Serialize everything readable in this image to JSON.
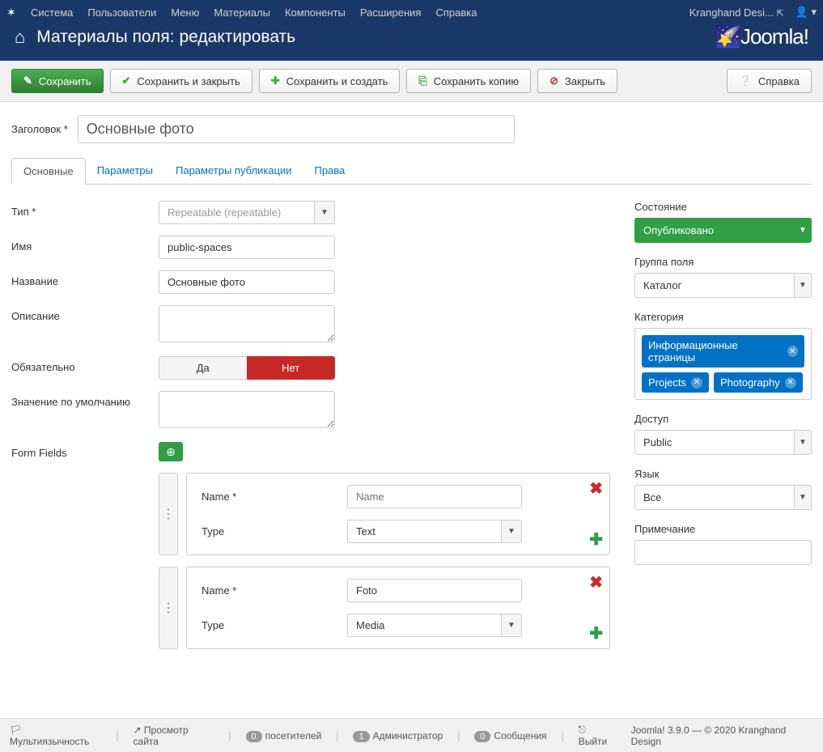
{
  "topnav": {
    "menus": [
      "Система",
      "Пользователи",
      "Меню",
      "Материалы",
      "Компоненты",
      "Расширения",
      "Справка"
    ],
    "site_name": "Kranghand Desi..."
  },
  "header": {
    "title": "Материалы поля: редактировать",
    "brand": "Joomla!"
  },
  "toolbar": {
    "save": "Сохранить",
    "save_close": "Сохранить и закрыть",
    "save_new": "Сохранить и создать",
    "save_copy": "Сохранить копию",
    "close": "Закрыть",
    "help": "Справка"
  },
  "title_field": {
    "label": "Заголовок *",
    "value": "Основные фото"
  },
  "tabs": [
    "Основные",
    "Параметры",
    "Параметры публикации",
    "Права"
  ],
  "fields": {
    "type": {
      "label": "Тип *",
      "value": "Repeatable (repeatable)"
    },
    "name": {
      "label": "Имя",
      "value": "public-spaces"
    },
    "title": {
      "label": "Название",
      "value": "Основные фото"
    },
    "desc": {
      "label": "Описание",
      "value": ""
    },
    "required": {
      "label": "Обязательно",
      "yes": "Да",
      "no": "Нет"
    },
    "default": {
      "label": "Значение по умолчанию",
      "value": ""
    },
    "formfields": {
      "label": "Form Fields"
    }
  },
  "repeat": [
    {
      "name_label": "Name *",
      "name_value": "",
      "name_placeholder": "Name",
      "type_label": "Type",
      "type_value": "Text"
    },
    {
      "name_label": "Name *",
      "name_value": "Foto",
      "name_placeholder": "Name",
      "type_label": "Type",
      "type_value": "Media"
    }
  ],
  "sidebar": {
    "status": {
      "label": "Состояние",
      "value": "Опубликовано"
    },
    "group": {
      "label": "Группа поля",
      "value": "Каталог"
    },
    "category": {
      "label": "Категория",
      "tags": [
        "Информационные страницы",
        "Projects",
        "Photography"
      ]
    },
    "access": {
      "label": "Доступ",
      "value": "Public"
    },
    "language": {
      "label": "Язык",
      "value": "Все"
    },
    "note": {
      "label": "Примечание",
      "value": ""
    }
  },
  "footer": {
    "multilang": "Мультиязычность",
    "view_site": "Просмотр сайта",
    "visitors_count": "0",
    "visitors": "посетителей",
    "admin_count": "1",
    "admin": "Администратор",
    "msg_count": "0",
    "msg": "Сообщения",
    "logout": "Выйти",
    "copyright": "Joomla! 3.9.0 — © 2020 Kranghand Design"
  }
}
